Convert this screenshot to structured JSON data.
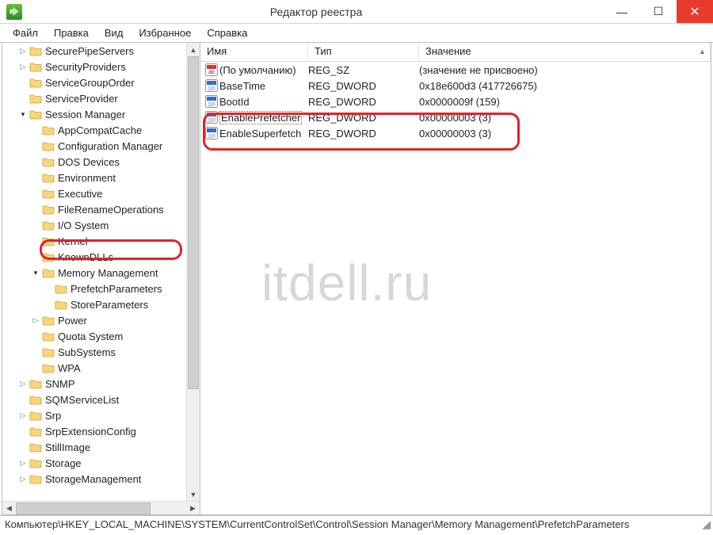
{
  "title": "Редактор реестра",
  "watermark": "itdell.ru",
  "menu": {
    "file": "Файл",
    "edit": "Правка",
    "view": "Вид",
    "fav": "Избранное",
    "help": "Справка"
  },
  "cols": {
    "name": "Имя",
    "type": "Тип",
    "value": "Значение"
  },
  "tree": [
    {
      "d": 1,
      "e": "▷",
      "t": "SecurePipeServers"
    },
    {
      "d": 1,
      "e": "▷",
      "t": "SecurityProviders"
    },
    {
      "d": 1,
      "e": "",
      "t": "ServiceGroupOrder"
    },
    {
      "d": 1,
      "e": "",
      "t": "ServiceProvider"
    },
    {
      "d": 1,
      "e": "▿",
      "open": true,
      "t": "Session Manager"
    },
    {
      "d": 2,
      "e": "",
      "t": "AppCompatCache"
    },
    {
      "d": 2,
      "e": "",
      "t": "Configuration Manager"
    },
    {
      "d": 2,
      "e": "",
      "t": "DOS Devices"
    },
    {
      "d": 2,
      "e": "",
      "t": "Environment"
    },
    {
      "d": 2,
      "e": "",
      "t": "Executive"
    },
    {
      "d": 2,
      "e": "",
      "t": "FileRenameOperations"
    },
    {
      "d": 2,
      "e": "",
      "t": "I/O System"
    },
    {
      "d": 2,
      "e": "",
      "t": "Kernel"
    },
    {
      "d": 2,
      "e": "",
      "t": "KnownDLLs"
    },
    {
      "d": 2,
      "e": "▿",
      "open": true,
      "t": "Memory Management"
    },
    {
      "d": 3,
      "e": "",
      "t": "PrefetchParameters",
      "hl": true
    },
    {
      "d": 3,
      "e": "",
      "t": "StoreParameters"
    },
    {
      "d": 2,
      "e": "▷",
      "t": "Power"
    },
    {
      "d": 2,
      "e": "",
      "t": "Quota System"
    },
    {
      "d": 2,
      "e": "",
      "t": "SubSystems"
    },
    {
      "d": 2,
      "e": "",
      "t": "WPA"
    },
    {
      "d": 1,
      "e": "▷",
      "t": "SNMP"
    },
    {
      "d": 1,
      "e": "",
      "t": "SQMServiceList"
    },
    {
      "d": 1,
      "e": "▷",
      "t": "Srp"
    },
    {
      "d": 1,
      "e": "",
      "t": "SrpExtensionConfig"
    },
    {
      "d": 1,
      "e": "",
      "t": "StillImage"
    },
    {
      "d": 1,
      "e": "▷",
      "t": "Storage"
    },
    {
      "d": 1,
      "e": "▷",
      "t": "StorageManagement"
    }
  ],
  "values": [
    {
      "kind": "sz",
      "name": "(По умолчанию)",
      "type": "REG_SZ",
      "value": "(значение не присвоено)"
    },
    {
      "kind": "dw",
      "name": "BaseTime",
      "type": "REG_DWORD",
      "value": "0x18e600d3 (417726675)"
    },
    {
      "kind": "dw",
      "name": "BootId",
      "type": "REG_DWORD",
      "value": "0x0000009f (159)"
    },
    {
      "kind": "dw",
      "name": "EnablePrefetcher",
      "type": "REG_DWORD",
      "value": "0x00000003 (3)",
      "sel": true
    },
    {
      "kind": "dw",
      "name": "EnableSuperfetch",
      "type": "REG_DWORD",
      "value": "0x00000003 (3)"
    }
  ],
  "status": "Компьютер\\HKEY_LOCAL_MACHINE\\SYSTEM\\CurrentControlSet\\Control\\Session Manager\\Memory Management\\PrefetchParameters"
}
